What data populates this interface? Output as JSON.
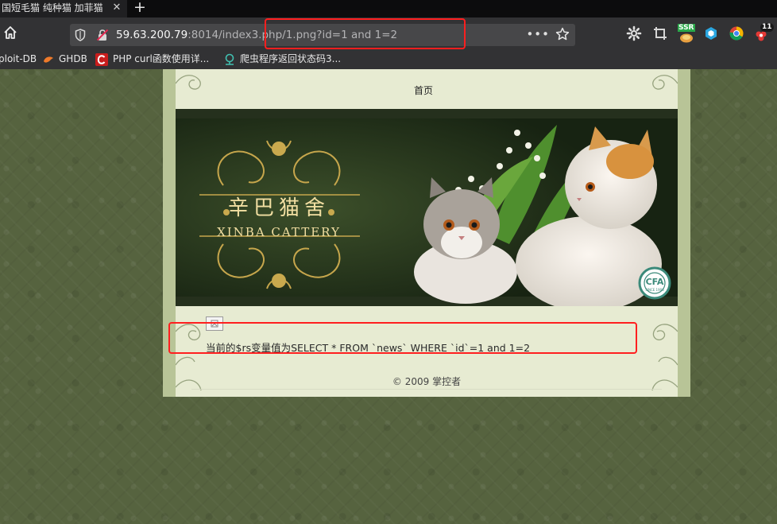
{
  "browser": {
    "tab": {
      "title": "国短毛猫 纯种猫 加菲猫",
      "close": "✕"
    },
    "new_tab": "+",
    "url": {
      "host": "59.63.200.79",
      "rest": ":8014/index3.php/1.png?id=1 and 1=2",
      "menu": "•••"
    },
    "extensions": {
      "ssr_label": "SSR",
      "badge_count": "11"
    },
    "bookmarks": [
      {
        "label": "ploit-DB",
        "icon": "database-icon"
      },
      {
        "label": "GHDB",
        "icon": "ghdb-icon"
      },
      {
        "label": "PHP curl函数使用详...",
        "icon": "csdn-icon"
      },
      {
        "label": "爬虫程序返回状态码3...",
        "icon": "globe-pin-icon"
      }
    ]
  },
  "page": {
    "nav": {
      "home": "首页"
    },
    "banner": {
      "title_cn": "辛巴猫舍",
      "title_en": "XINBA CATTERY",
      "seal": "CFA",
      "seal_sub": "SINCE 1906"
    },
    "content_text": "当前的$rs变量值为SELECT * FROM `news` WHERE `id`=1 and 1=2",
    "footer": "© 2009 掌控者"
  },
  "colors": {
    "highlight": "#ff1f1f",
    "page_bg": "#56633f",
    "toolbar": "#323234"
  }
}
